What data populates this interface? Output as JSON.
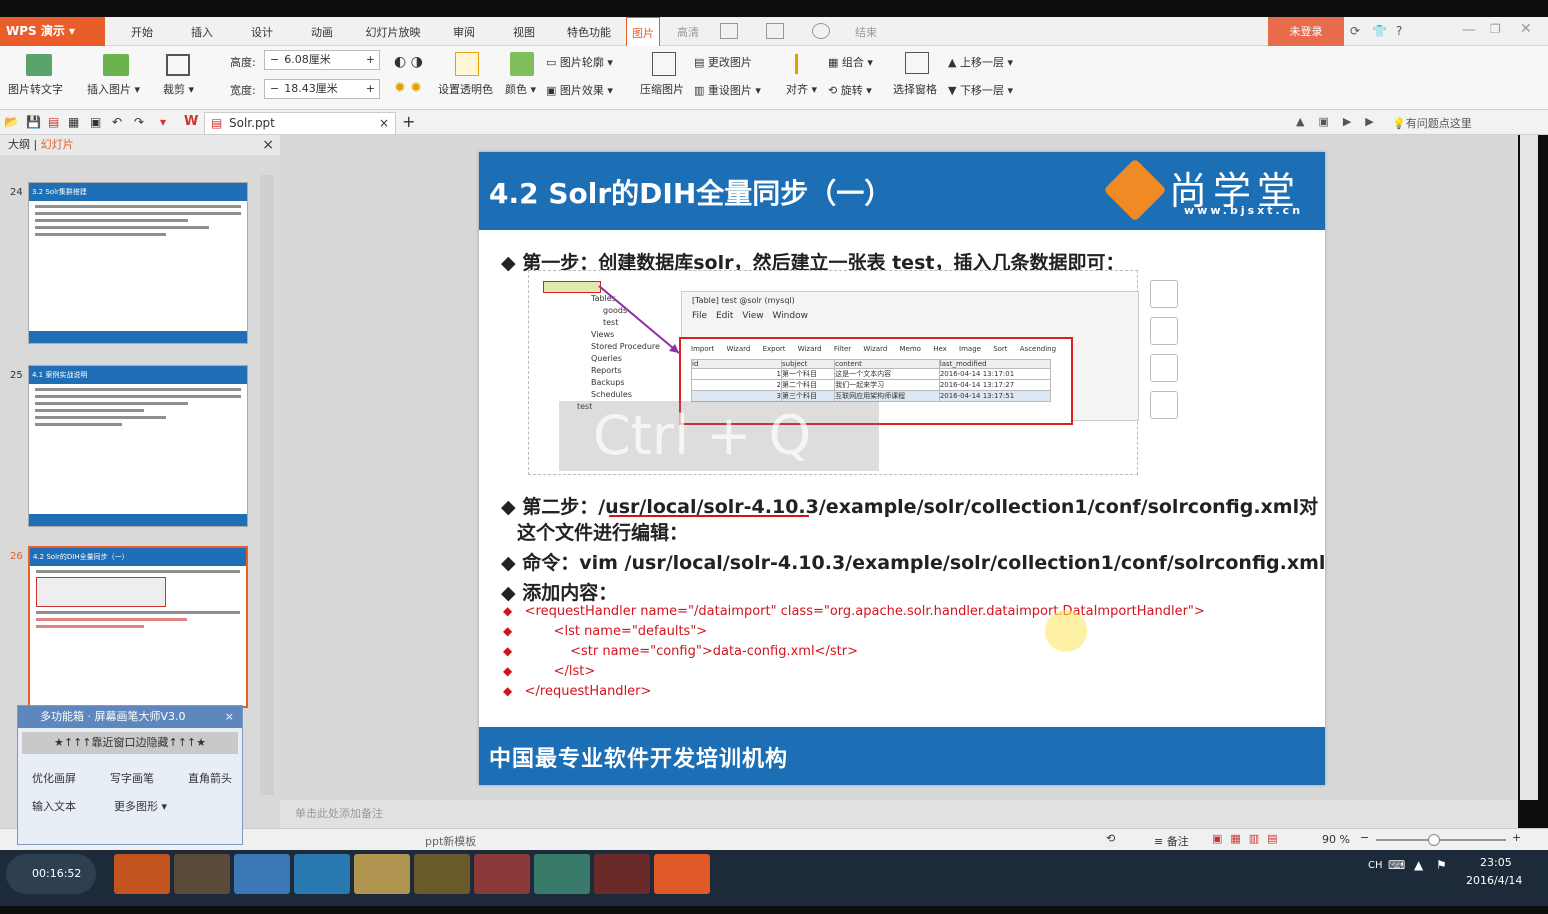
{
  "topbar": {
    "app": "WPS 演示",
    "tabs": [
      "开始",
      "插入",
      "设计",
      "动画",
      "幻灯片放映",
      "审阅",
      "视图",
      "特色功能",
      "图片",
      "高清",
      "",
      "",
      "",
      "结束"
    ],
    "login": "未登录",
    "help": "?"
  },
  "ribbon": {
    "pic_to_text": "图片转文字",
    "insert_pic": "插入图片",
    "crop": "裁剪",
    "height_label": "高度:",
    "height_value": "6.08厘米",
    "width_label": "宽度:",
    "width_value": "18.43厘米",
    "set_transparent": "设置透明色",
    "color": "颜色",
    "pic_outline": "图片轮廓",
    "pic_effect": "图片效果",
    "change_pic": "更改图片",
    "compress": "压缩图片",
    "reset_pic": "重设图片",
    "align": "对齐",
    "group": "组合",
    "rotate": "旋转",
    "selection_pane": "选择窗格",
    "bring_forward": "上移一层",
    "send_backward": "下移一层"
  },
  "qa": {
    "file_tab": "Solr.ppt",
    "hint": "有问题点这里"
  },
  "panel": {
    "outline": "大纲",
    "slides": "幻灯片",
    "thumbs": [
      {
        "num": "24",
        "title": "3.2 Solr集群搭建"
      },
      {
        "num": "25",
        "title": "4.1 案例实战说明"
      },
      {
        "num": "26",
        "title": "4.2 Solr的DIH全量同步（一）"
      }
    ],
    "footer_text": "中国最专业软件开发培训机构"
  },
  "slide": {
    "title": "4.2 Solr的DIH全量同步（一）",
    "logo_cn": "尚学堂",
    "logo_url": "www.bjsxt.cn",
    "step1": "第一步：创建数据库solr，然后建立一张表 test，插入几条数据即可：",
    "step2a": "第二步：/usr/local/solr-4.10.3/example/solr/collection1/conf/solrconfig.xml对",
    "step2b": "这个文件进行编辑：",
    "cmd": "命令：vim /usr/local/solr-4.10.3/example/solr/collection1/conf/solrconfig.xml",
    "add": "添加内容：",
    "code": [
      "<requestHandler name=\"/dataimport\" class=\"org.apache.solr.handler.dataimport.DataImportHandler\">",
      "<lst name=\"defaults\">",
      "<str name=\"config\">data-config.xml</str>",
      "</lst>",
      "</requestHandler>"
    ],
    "footer": "中国最专业软件开发培训机构",
    "overlay": "Ctrl + Q"
  },
  "db": {
    "tree": [
      "Tables",
      "goods",
      "test",
      "Views",
      "Stored Procedure",
      "Queries",
      "Reports",
      "Backups",
      "Schedules",
      "test"
    ],
    "win_title": "[Table] test @solr (mysql)",
    "menu": [
      "File",
      "Edit",
      "View",
      "Window"
    ],
    "tools": [
      "Import Wizard",
      "Export Wizard",
      "Filter Wizard",
      "Memo",
      "Hex",
      "Image",
      "Sort Ascending"
    ],
    "cols": [
      "id",
      "subject",
      "content",
      "last_modified"
    ],
    "rows": [
      [
        "1",
        "第一个科目",
        "这是一个文本内容",
        "2016-04-14 13:17:01"
      ],
      [
        "2",
        "第二个科目",
        "我们一起来学习",
        "2016-04-14 13:17:27"
      ],
      [
        "3",
        "第三个科目",
        "互联网应用架构师课程",
        "2016-04-14 13:17:51"
      ]
    ]
  },
  "notes": "单击此处添加备注",
  "status": {
    "template": "ppt新模板",
    "notes": "备注",
    "zoom": "90 %"
  },
  "float": {
    "title": "多功能箱 · 屏幕画笔大师V3.0",
    "banner": "★↑↑↑靠近窗口边隐藏↑↑↑★",
    "items": [
      "优化画屏",
      "写字画笔",
      "直角箭头",
      "输入文本",
      "更多图形"
    ]
  },
  "taskbar": {
    "timer": "00:16:52",
    "time": "23:05",
    "date": "2016/4/14",
    "lang": "CH"
  }
}
